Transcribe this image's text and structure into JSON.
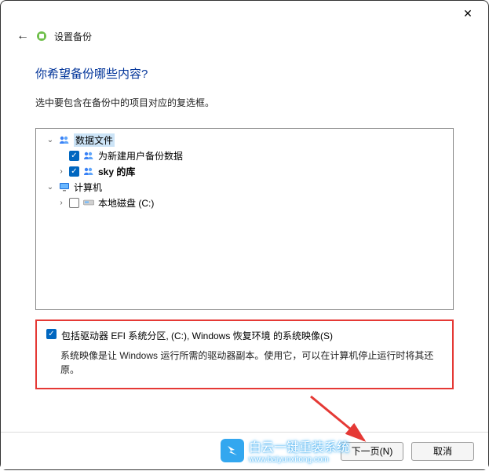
{
  "header": {
    "title": "设置备份"
  },
  "main": {
    "heading": "你希望备份哪些内容?",
    "instruction": "选中要包含在备份中的项目对应的复选框。"
  },
  "tree": {
    "data_files": {
      "label": "数据文件",
      "expanded": true,
      "children": [
        {
          "label": "为新建用户备份数据",
          "checked": true
        },
        {
          "label": "sky 的库",
          "checked": true,
          "expandable": true
        }
      ]
    },
    "computer": {
      "label": "计算机",
      "expanded": true,
      "children": [
        {
          "label": "本地磁盘 (C:)",
          "checked": false,
          "expandable": true
        }
      ]
    }
  },
  "system_image": {
    "checked": true,
    "label": "包括驱动器 EFI 系统分区, (C:), Windows 恢复环境 的系统映像(S)",
    "description": "系统映像是让 Windows 运行所需的驱动器副本。使用它，可以在计算机停止运行时将其还原。"
  },
  "footer": {
    "next": "下一页(N)",
    "cancel": "取消"
  },
  "watermark": {
    "brand": "白云一键重装系统",
    "url": "www.baiyunxitong.com"
  }
}
